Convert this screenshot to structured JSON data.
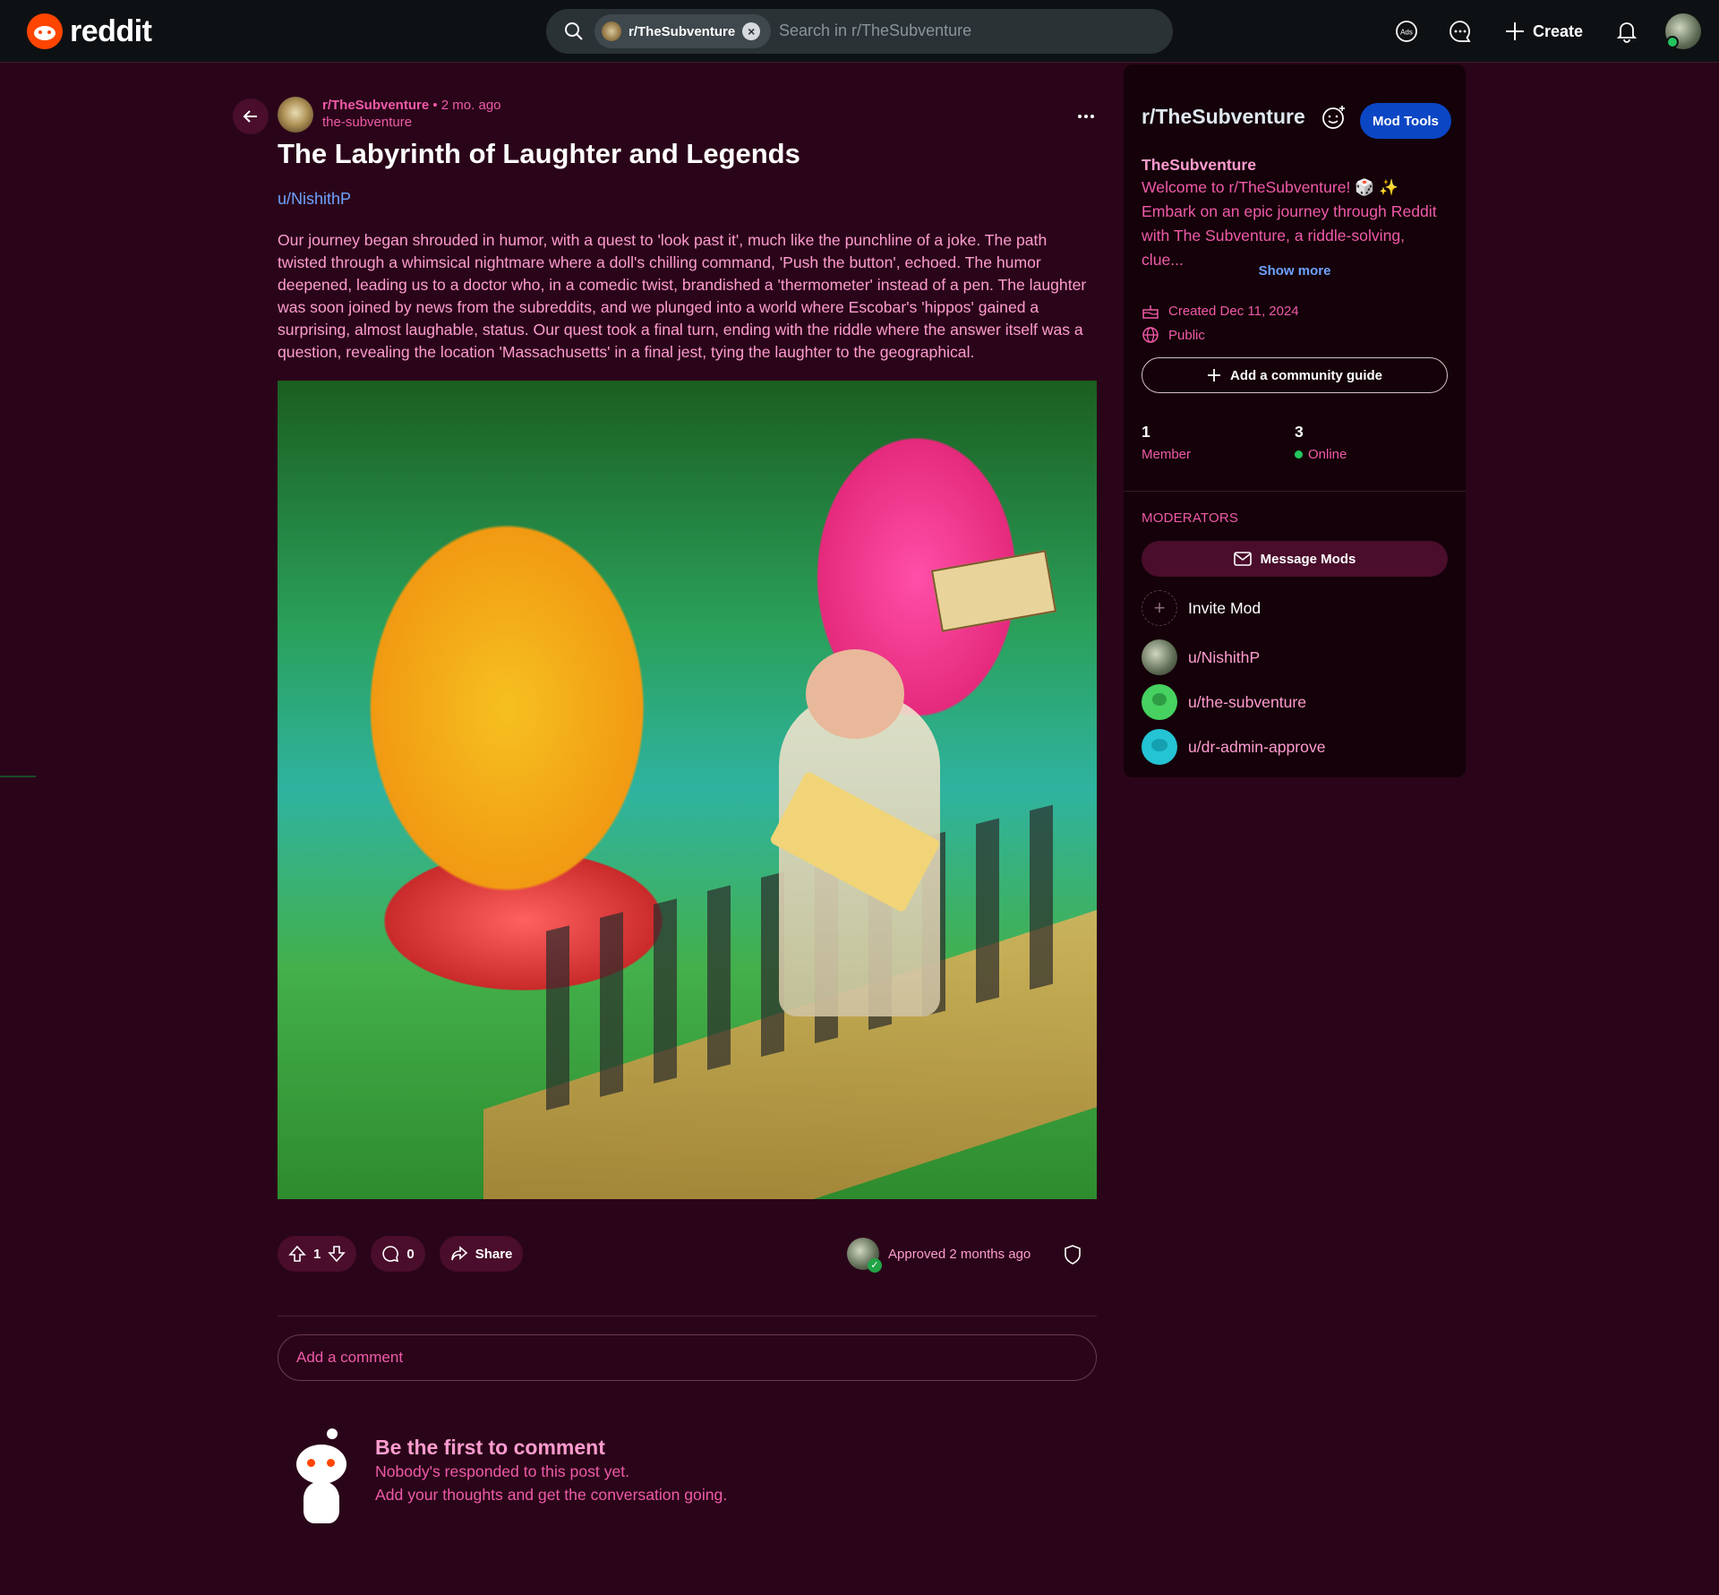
{
  "header": {
    "logo_text": "reddit",
    "search_chip": "r/TheSubventure",
    "search_placeholder": "Search in r/TheSubventure",
    "ads_label": "Ads",
    "create_label": "Create"
  },
  "post": {
    "subreddit": "r/TheSubventure",
    "separator": "•",
    "time_ago": "2 mo. ago",
    "username": "the-subventure",
    "title": "The Labyrinth of Laughter and Legends",
    "author": "u/NishithP",
    "body": "Our journey began shrouded in humor, with a quest to 'look past it', much like the punchline of a joke. The path twisted through a whimsical nightmare where a doll's chilling command, 'Push the button', echoed. The humor deepened, leading us to a doctor who, in a comedic twist, brandished a 'thermometer' instead of a pen. The laughter was soon joined by news from the subreddits, and we plunged into a world where Escobar's 'hippos' gained a surprising, almost laughable, status. Our quest took a final turn, ending with the riddle where the answer itself was a question, revealing the location 'Massachusetts' in a final jest, tying the laughter to the geographical.",
    "vote_count": "1",
    "comment_count": "0",
    "share_label": "Share",
    "approved_text": "Approved 2 months ago"
  },
  "comments": {
    "placeholder": "Add a comment",
    "empty_title": "Be the first to comment",
    "empty_line1": "Nobody's responded to this post yet.",
    "empty_line2": "Add your thoughts and get the conversation going."
  },
  "sidebar": {
    "community": "r/TheSubventure",
    "mod_tools": "Mod Tools",
    "name": "TheSubventure",
    "description": "Welcome to r/TheSubventure! 🎲 ✨ Embark on an epic journey through Reddit with The Subventure, a riddle-solving, clue...",
    "show_more": "Show more",
    "created": "Created Dec 11, 2024",
    "visibility": "Public",
    "add_guide": "Add a community guide",
    "members_count": "1",
    "members_label": "Member",
    "online_count": "3",
    "online_label": "Online",
    "moderators_title": "MODERATORS",
    "message_mods": "Message Mods",
    "invite_mod": "Invite Mod",
    "mods": [
      "u/NishithP",
      "u/the-subventure",
      "u/dr-admin-approve"
    ]
  },
  "colors": {
    "background": "#2a0519",
    "accent_pink": "#f05aa8",
    "link_blue": "#6ea2ff",
    "mod_tools_blue": "#0b46c4"
  }
}
